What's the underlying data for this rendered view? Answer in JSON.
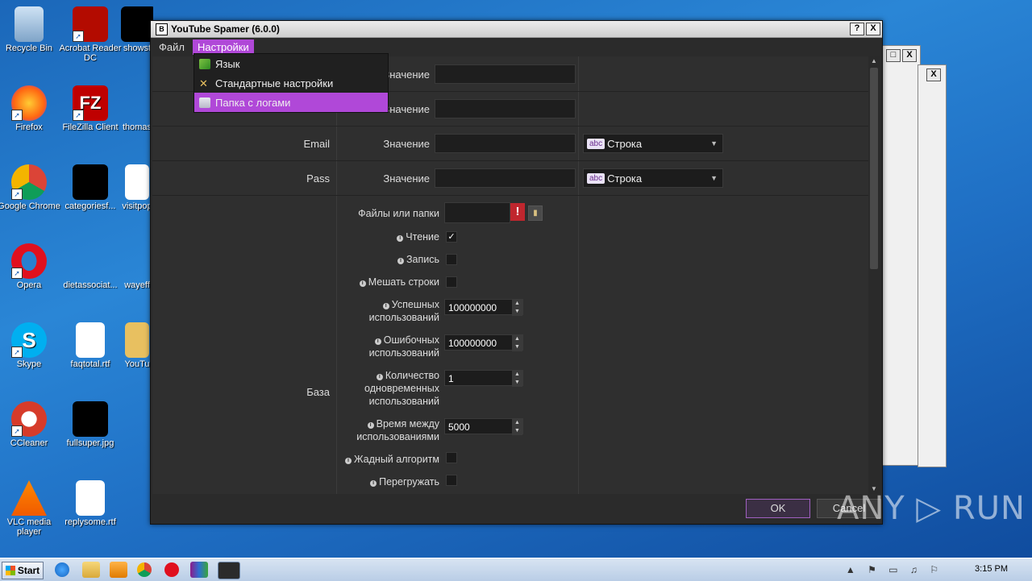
{
  "desktop": {
    "icons": [
      {
        "label": "Recycle Bin"
      },
      {
        "label": "Acrobat Reader DC"
      },
      {
        "label": "showst"
      },
      {
        "label": "Firefox"
      },
      {
        "label": "FileZilla Client"
      },
      {
        "label": "thomas"
      },
      {
        "label": "Google Chrome"
      },
      {
        "label": "categoriesf..."
      },
      {
        "label": "visitpop"
      },
      {
        "label": "Opera"
      },
      {
        "label": "dietassociat..."
      },
      {
        "label": "wayeff"
      },
      {
        "label": "Skype"
      },
      {
        "label": "faqtotal.rtf"
      },
      {
        "label": "YouTu"
      },
      {
        "label": "CCleaner"
      },
      {
        "label": "fullsuper.jpg"
      },
      {
        "label": "VLC media player"
      },
      {
        "label": "replysome.rtf"
      }
    ]
  },
  "window": {
    "title": "YouTube Spamer (6.0.0)",
    "help_btn": "?",
    "close_btn": "X"
  },
  "menubar": {
    "file": "Файл",
    "settings": "Настройки"
  },
  "dropdown": {
    "items": [
      {
        "label": "Язык",
        "icon": "language-icon"
      },
      {
        "label": "Стандартные настройки",
        "icon": "tools-icon"
      },
      {
        "label": "Папка с логами",
        "icon": "folder-icon"
      }
    ]
  },
  "form": {
    "rows": [
      {
        "label": "",
        "value_label": "Значение"
      },
      {
        "label": "",
        "value_label": "Значение"
      },
      {
        "label": "Email",
        "value_label": "Значение",
        "type": "Строка"
      },
      {
        "label": "Pass",
        "value_label": "Значение",
        "type": "Строка"
      }
    ],
    "base_label": "База",
    "files_label": "Файлы или папки",
    "options": {
      "read": "Чтение",
      "write": "Запись",
      "shuffle": "Мешать строки",
      "success_uses": "Успешных использований",
      "error_uses": "Ошибочных использований",
      "concurrent_uses": "Количество одновременных использований",
      "delay": "Время между использованиями",
      "greedy": "Жадный алгоритм",
      "reload": "Перегружать"
    },
    "values": {
      "success_uses": "100000000",
      "error_uses": "100000000",
      "concurrent_uses": "1",
      "delay": "5000"
    },
    "checks": {
      "read": "✓"
    }
  },
  "buttons": {
    "ok": "OK",
    "cancel": "Cancel"
  },
  "taskbar": {
    "start": "Start",
    "time": "3:15 PM"
  },
  "watermark": "ANY ▷ RUN"
}
